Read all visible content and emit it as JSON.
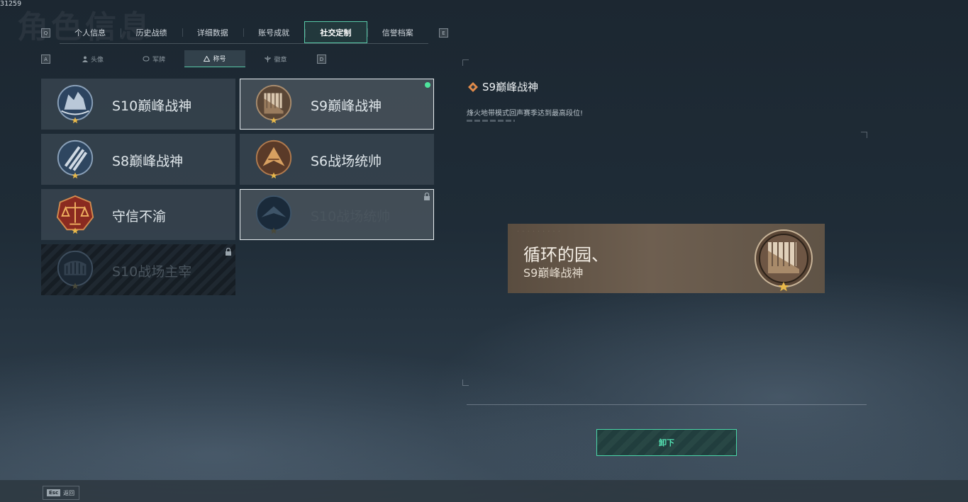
{
  "debug_id": "31259",
  "watermark": "角色信息",
  "tabs": [
    {
      "label": "个人信息",
      "active": false
    },
    {
      "label": "历史战绩",
      "active": false
    },
    {
      "label": "详细数据",
      "active": false
    },
    {
      "label": "账号成就",
      "active": false
    },
    {
      "label": "社交定制",
      "active": true
    },
    {
      "label": "信誉档案",
      "active": false
    }
  ],
  "tab_keys": {
    "left": "Q",
    "right": "E"
  },
  "subtabs": [
    {
      "label": "头像",
      "icon": "person-icon",
      "active": false
    },
    {
      "label": "军牌",
      "icon": "dogtag-icon",
      "active": false
    },
    {
      "label": "称号",
      "icon": "triangle-icon",
      "active": true
    },
    {
      "label": "徽章",
      "icon": "badge-icon",
      "active": false
    }
  ],
  "subtab_keys": {
    "left": "A",
    "right": "D"
  },
  "titles": [
    {
      "name": "S10巅峰战神",
      "emblem": "blue-crown-emblem",
      "locked": false,
      "selected": false,
      "equipped": false
    },
    {
      "name": "S9巅峰战神",
      "emblem": "bronze-fortress-emblem",
      "locked": false,
      "selected": true,
      "equipped": true
    },
    {
      "name": "S8巅峰战神",
      "emblem": "blue-stripes-emblem",
      "locked": false,
      "selected": false,
      "equipped": false
    },
    {
      "name": "S6战场统帅",
      "emblem": "bronze-jet-emblem",
      "locked": false,
      "selected": false,
      "equipped": false
    },
    {
      "name": "守信不渝",
      "emblem": "red-scales-emblem",
      "locked": false,
      "selected": false,
      "equipped": false
    },
    {
      "name": "S10战场统帅",
      "emblem": "dark-jet-emblem",
      "locked": true,
      "selected": true,
      "equipped": false
    },
    {
      "name": "S10战场主宰",
      "emblem": "dark-colosseum-emblem",
      "locked": true,
      "selected": false,
      "equipped": false
    }
  ],
  "detail": {
    "title": "S9巅峰战神",
    "description": "烽火地带模式回声赛季达到最高段位!"
  },
  "banner": {
    "player_name": "循环的园、",
    "rank": "S9巅峰战神"
  },
  "unequip_label": "卸下",
  "footer": {
    "esc_key": "Esc",
    "esc_label": "返回"
  },
  "colors": {
    "accent": "#58c9a8",
    "equipped_dot": "#4ee39c",
    "bronze": "#8a6e52",
    "blue": "#3b5a82"
  }
}
